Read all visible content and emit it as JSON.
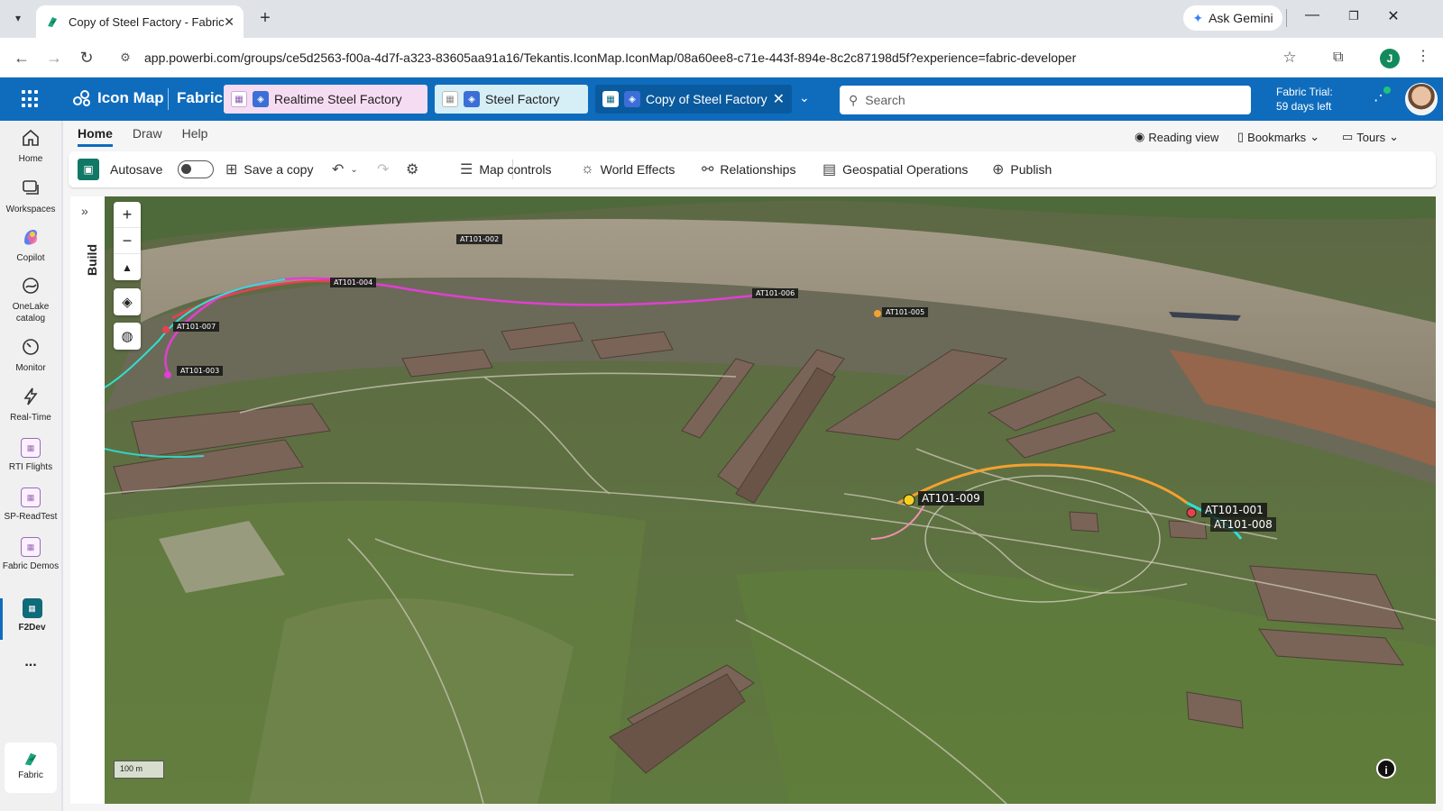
{
  "browser": {
    "tab_title": "Copy of Steel Factory - Fabric",
    "ask_gemini": "Ask Gemini",
    "url": "app.powerbi.com/groups/ce5d2563-f00a-4d7f-a323-83605aa91a16/Tekantis.IconMap.IconMap/08a60ee8-c71e-443f-894e-8c2c87198d5f?experience=fabric-developer",
    "profile_initial": "J"
  },
  "fabric": {
    "app_name": "Icon Map",
    "product": "Fabric",
    "tabs": [
      {
        "label": "Realtime Steel Factory"
      },
      {
        "label": "Steel Factory"
      },
      {
        "label": "Copy of Steel Factory"
      }
    ],
    "search_placeholder": "Search",
    "trial_line1": "Fabric Trial:",
    "trial_line2": "59 days left"
  },
  "rail": {
    "items": [
      {
        "label": "Home"
      },
      {
        "label": "Workspaces"
      },
      {
        "label": "Copilot"
      },
      {
        "label": "OneLake catalog"
      },
      {
        "label": "Monitor"
      },
      {
        "label": "Real-Time"
      },
      {
        "label": "RTI Flights"
      },
      {
        "label": "SP-ReadTest"
      },
      {
        "label": "Fabric Demos"
      },
      {
        "label": "F2Dev"
      }
    ],
    "more": "...",
    "bottom": "Fabric"
  },
  "ribbon": {
    "tabs": [
      "Home",
      "Draw",
      "Help"
    ],
    "reading_view": "Reading view",
    "bookmarks": "Bookmarks",
    "tours": "Tours",
    "autosave": "Autosave",
    "autosave_on": false,
    "save_copy": "Save a copy",
    "map_controls": "Map controls",
    "world_effects": "World Effects",
    "relationships": "Relationships",
    "geospatial": "Geospatial Operations",
    "publish": "Publish"
  },
  "build_panel": {
    "label": "Build"
  },
  "map": {
    "labels": [
      {
        "text": "AT101-002"
      },
      {
        "text": "AT101-004"
      },
      {
        "text": "AT101-006"
      },
      {
        "text": "AT101-005"
      },
      {
        "text": "AT101-007"
      },
      {
        "text": "AT101-003"
      },
      {
        "text": "AT101-009"
      },
      {
        "text": "AT101-001"
      },
      {
        "text": "AT101-008"
      }
    ],
    "scale": "100 m",
    "track_colors": {
      "magenta": "#e040d0",
      "cyan": "#30e0d0",
      "orange": "#f5a030",
      "pink": "#f090b0",
      "red": "#e84050"
    }
  }
}
